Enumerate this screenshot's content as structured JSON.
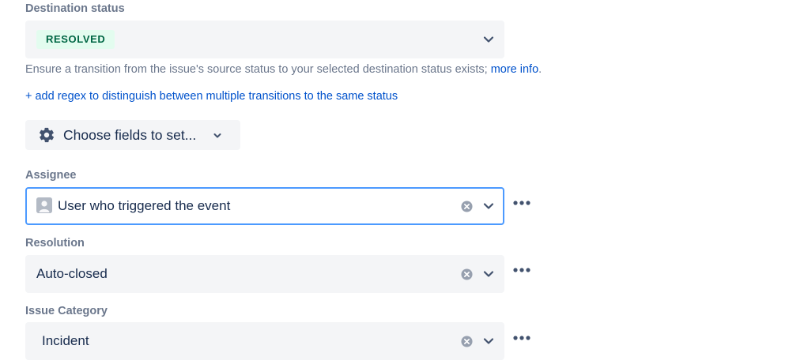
{
  "destination_status": {
    "label": "Destination status",
    "value": "RESOLVED"
  },
  "help": {
    "text": "Ensure a transition from the issue's source status to your selected destination status exists; ",
    "link": "more info",
    "suffix": "."
  },
  "regex_link": "+ add regex to distinguish between multiple transitions to the same status",
  "choose_fields": {
    "label": "Choose fields to set..."
  },
  "fields": {
    "assignee": {
      "label": "Assignee",
      "value": "User who triggered the event"
    },
    "resolution": {
      "label": "Resolution",
      "value": "Auto-closed"
    },
    "issue_category": {
      "label": "Issue Category",
      "value": "Incident"
    }
  },
  "icons": {
    "chevron": "chevron-down-icon",
    "clear": "clear-icon",
    "more": "more-icon",
    "gear": "gear-icon",
    "avatar": "avatar-icon"
  },
  "colors": {
    "link": "#0052cc",
    "lozenge_bg": "#e3fcef",
    "lozenge_text": "#006644",
    "focus_border": "#4c9aff",
    "field_bg": "#f4f5f7"
  }
}
